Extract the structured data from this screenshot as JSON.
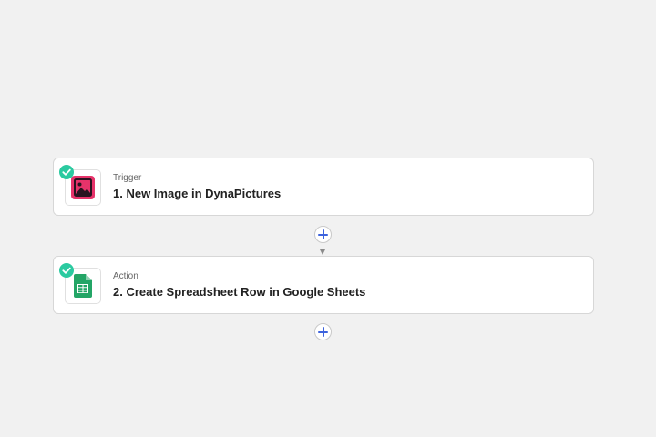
{
  "colors": {
    "canvas_background": "#f1f1f1",
    "success_badge": "#2bcaa0",
    "dynapictures_brand": "#e6336a",
    "google_sheets_brand": "#23a566",
    "add_button_plus": "#3d63dd"
  },
  "steps": [
    {
      "kind": "Trigger",
      "title": "1. New Image in DynaPictures",
      "app_icon": "dynapictures-icon",
      "status": "complete",
      "status_icon": "check-circle-icon"
    },
    {
      "kind": "Action",
      "title": "2. Create Spreadsheet Row in Google Sheets",
      "app_icon": "google-sheets-icon",
      "status": "complete",
      "status_icon": "check-circle-icon"
    }
  ],
  "add_step_buttons": [
    {
      "icon": "plus-icon"
    },
    {
      "icon": "plus-icon"
    }
  ]
}
